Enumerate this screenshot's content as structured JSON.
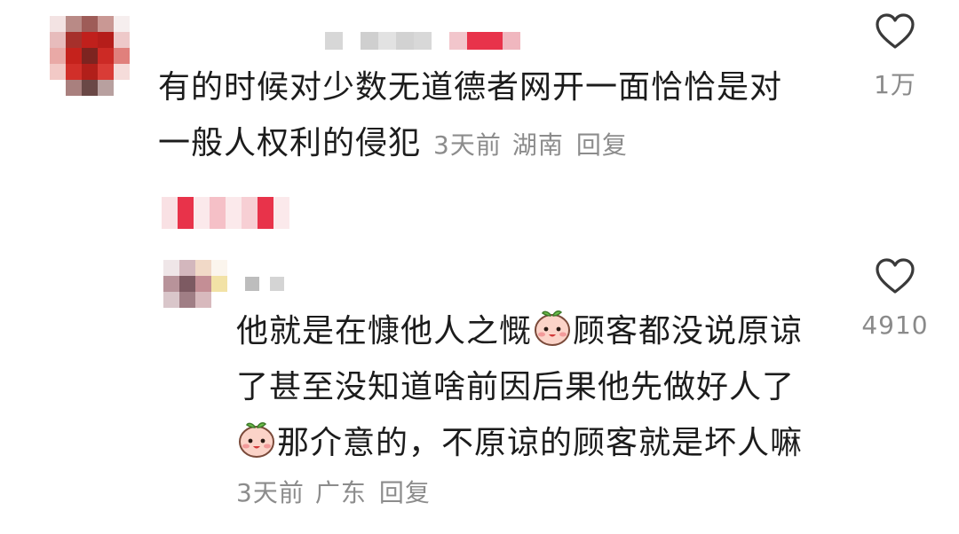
{
  "comment": {
    "line1": "有的时候对少数无道德者网开一面恰恰是对",
    "line2": "一般人权利的侵犯",
    "time": "3天前",
    "location": "湖南",
    "reply_label": "回复",
    "like_count": "1万"
  },
  "reply": {
    "line1a": "他就是在慷他人之慨",
    "line1b": "顾客都没说原谅",
    "line2": "了甚至没知道啥前因后果他先做好人了",
    "line3": "那介意的，不原谅的顾客就是坏人嘛",
    "time": "3天前",
    "location": "广东",
    "reply_label": "回复",
    "like_count": "4910"
  },
  "icons": {
    "like": "heart-outline-icon",
    "emoji": "peach-face-emoji-icon"
  },
  "colors": {
    "text": "#1c1c1c",
    "meta": "#8c8c8c",
    "like_icon": "#3a3a3a",
    "redacted_red": "#e8334a"
  }
}
